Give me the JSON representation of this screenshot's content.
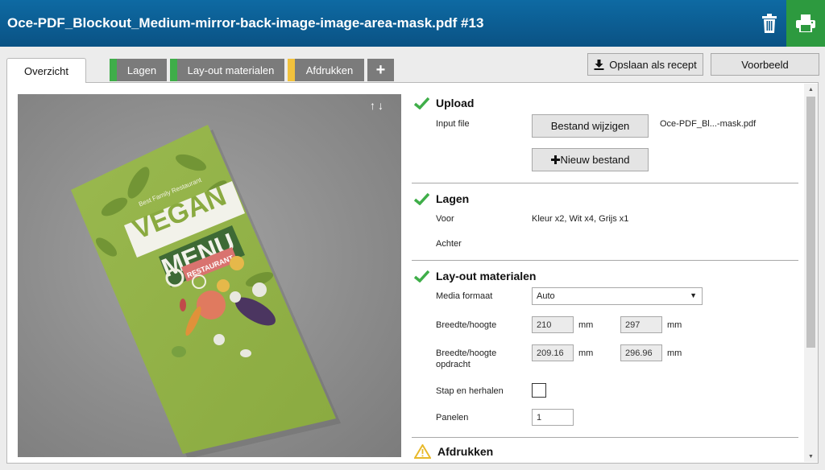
{
  "header": {
    "title": "Oce-PDF_Blockout_Medium-mirror-back-image-image-area-mask.pdf #13",
    "trash_icon": "trash-icon",
    "print_icon": "printer-icon",
    "print_color": "#2d9a3f"
  },
  "tabs": {
    "overview": "Overzicht",
    "layers": "Lagen",
    "layout": "Lay-out materialen",
    "print": "Afdrukken",
    "add": "+",
    "strip_colors": {
      "layers": "#3fae49",
      "layout": "#3fae49",
      "print": "#f2c23c"
    }
  },
  "toolbar": {
    "save_recipe": "Opslaan als recept",
    "preview": "Voorbeeld"
  },
  "preview_image": {
    "small_text": "Best Family Restaurant",
    "vegan": "VEGAN",
    "menu": "MENU",
    "restaurant": "RESTAURANT"
  },
  "sections": {
    "upload": {
      "title": "Upload",
      "input_file_label": "Input file",
      "change_file": "Bestand wijzigen",
      "file_name": "Oce-PDF_Bl...-mask.pdf",
      "new_file": "Nieuw bestand"
    },
    "layers": {
      "title": "Lagen",
      "front_label": "Voor",
      "front_value": "Kleur x2, Wit x4, Grijs x1",
      "back_label": "Achter"
    },
    "layout": {
      "title": "Lay-out materialen",
      "media_format_label": "Media formaat",
      "media_format_value": "Auto",
      "size_label": "Breedte/hoogte",
      "width": "210",
      "height": "297",
      "unit": "mm",
      "job_size_label": "Breedte/hoogte opdracht",
      "job_width": "209.16",
      "job_height": "296.96",
      "step_repeat_label": "Stap en herhalen",
      "panels_label": "Panelen",
      "panels_value": "1"
    },
    "print": {
      "title": "Afdrukken"
    }
  }
}
